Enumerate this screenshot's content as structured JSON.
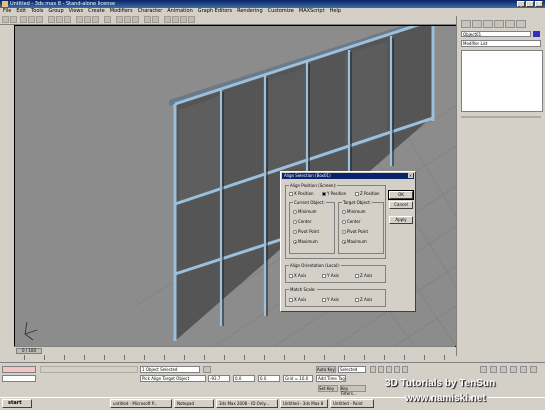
{
  "window": {
    "title": "Untitled - 3ds max 8 - Stand-alone license"
  },
  "menu": [
    "File",
    "Edit",
    "Tools",
    "Group",
    "Views",
    "Create",
    "Modifiers",
    "Character",
    "Animation",
    "Graph Editors",
    "Rendering",
    "Customize",
    "MAXScript",
    "Help"
  ],
  "command_panel": {
    "object_name": "Object01",
    "modifier_list": "Modifier List",
    "accent_color": "#3030c0"
  },
  "dialog": {
    "title": "Align Selection (Box01)",
    "position_group": "Align Position (Screen):",
    "x_position": "X Position",
    "y_position": "Y Position",
    "z_position": "Z Position",
    "current_group": "Current Object:",
    "target_group": "Target Object:",
    "options": [
      "Minimum",
      "Center",
      "Pivot Point",
      "Maximum"
    ],
    "orientation_group": "Align Orientation (Local):",
    "scale_group": "Match Scale:",
    "x_axis": "X Axis",
    "y_axis": "Y Axis",
    "z_axis": "Z Axis",
    "ok": "OK",
    "cancel": "Cancel",
    "apply": "Apply",
    "state": {
      "x_pos": false,
      "y_pos": true,
      "z_pos": false,
      "current": "Maximum",
      "target": "Maximum"
    }
  },
  "timeline": {
    "slider": "0 / 100"
  },
  "status": {
    "selected": "1 Object Selected",
    "prompt": "Pick Align Target Object",
    "x": "-93.7",
    "y": "0.0",
    "z": "0.0",
    "grid": "Grid = 10.0",
    "autokey": "Auto Key",
    "selected_dropdown": "Selected",
    "setkey": "Set Key",
    "key_filters": "Key Filters...",
    "addtime": "Add Time Tag"
  },
  "taskbar": {
    "start": "start",
    "items": [
      "untitled - Microsoft P...",
      "Notepad",
      "3ds Max 2008 - ID Only...",
      "Untitled - 3ds Max 8",
      "Untitled - Paint",
      "Desktop-Recorder",
      "Untitled - 3ds max 8"
    ]
  },
  "watermark": {
    "line1": "3D Tutorials by TenSun",
    "line2": "www.namiski.net"
  },
  "viewport": {
    "bg": "#8c8c8c",
    "frame_color": "#8ab4d8",
    "panel_color": "#505050"
  }
}
